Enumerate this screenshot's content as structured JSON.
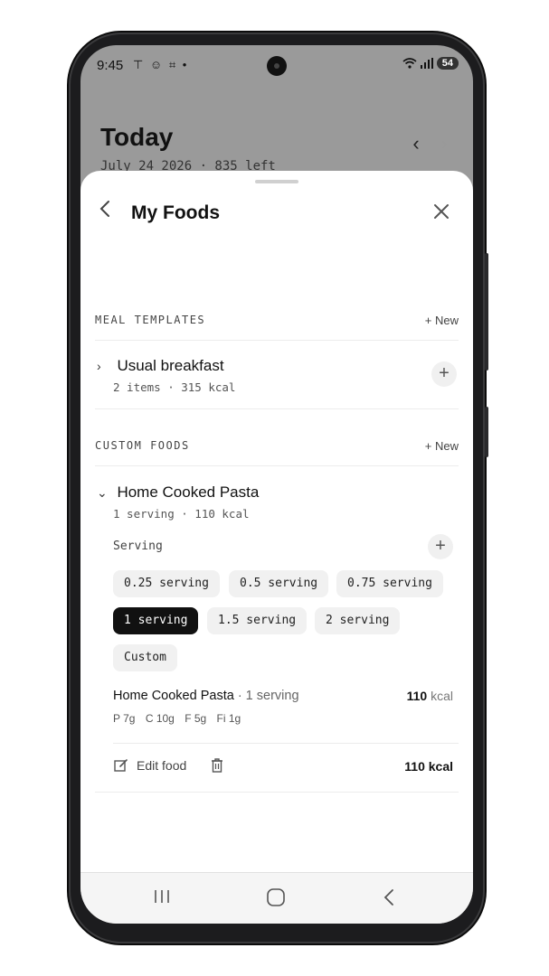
{
  "status_bar": {
    "time": "9:45",
    "notification_icons": "⊤ ☺ ⌗ •",
    "battery": "54"
  },
  "background_page": {
    "title": "Today",
    "subtitle": "July 24 2026 · 835 left"
  },
  "sheet": {
    "title": "My Foods",
    "meal_templates": {
      "label": "MEAL TEMPLATES",
      "new_label": "+ New",
      "items": [
        {
          "name": "Usual breakfast",
          "meta": "2 items · 315 kcal"
        }
      ]
    },
    "custom_foods": {
      "label": "CUSTOM FOODS",
      "new_label": "+ New",
      "items": [
        {
          "name": "Home Cooked Pasta",
          "meta": "1 serving · 110 kcal"
        }
      ]
    },
    "serving": {
      "label": "Serving",
      "options": [
        "0.25 serving",
        "0.5 serving",
        "0.75 serving",
        "1 serving",
        "1.5 serving",
        "2 serving",
        "Custom"
      ],
      "selected": "1 serving"
    },
    "summary": {
      "name": "Home Cooked Pasta",
      "serving_text": " · 1 serving",
      "kcal_value": "110",
      "kcal_unit": " kcal",
      "macros": [
        "P 7g",
        "C 10g",
        "F 5g",
        "Fi 1g"
      ]
    },
    "actions": {
      "edit_label": "Edit food",
      "total": "110 kcal"
    }
  }
}
